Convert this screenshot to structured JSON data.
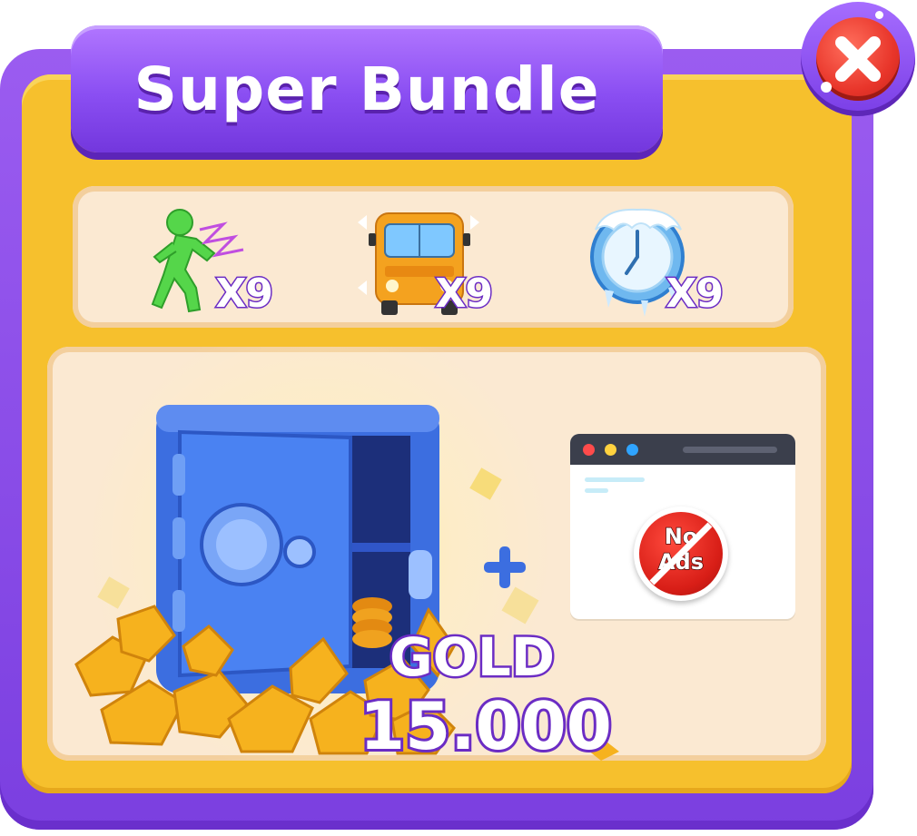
{
  "title": "Super Bundle",
  "close_button": {
    "icon": "close-icon"
  },
  "boosters": [
    {
      "icon": "running-man-icon",
      "multiplier": "X9"
    },
    {
      "icon": "bus-move-icon",
      "multiplier": "X9"
    },
    {
      "icon": "frozen-clock-icon",
      "multiplier": "X9"
    }
  ],
  "reward": {
    "currency_label": "GOLD",
    "amount": "15.000",
    "icon": "vault-with-gold-icon"
  },
  "extra": {
    "plus_icon": "plus-icon",
    "no_ads_line1": "No",
    "no_ads_line2": "Ads"
  },
  "colors": {
    "frame": "#7b3fe0",
    "panel": "#f6c02d",
    "card": "#fbe9d2",
    "outline": "#6b2cc4",
    "close": "#e8352a"
  }
}
